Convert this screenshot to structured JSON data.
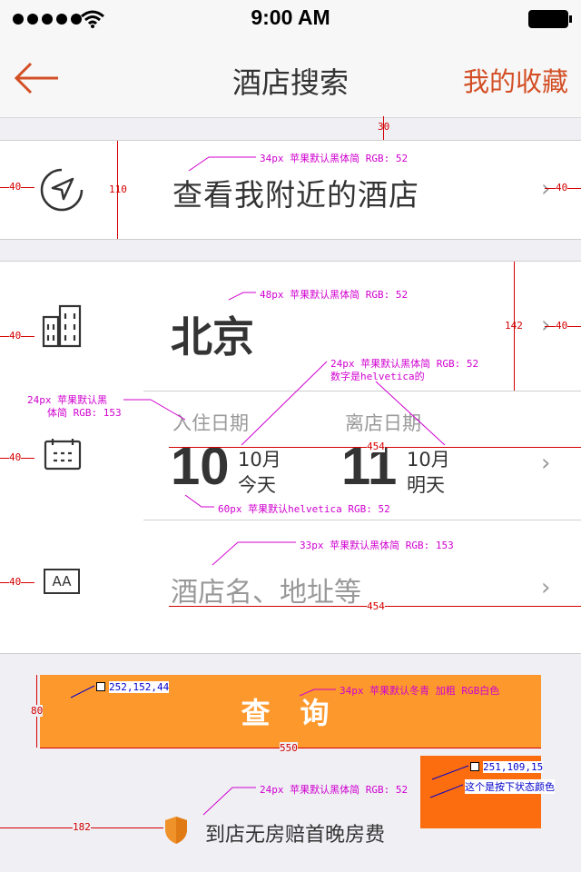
{
  "status_bar": {
    "time": "9:00 AM"
  },
  "nav": {
    "title": "酒店搜索",
    "right_label": "我的收藏",
    "back_icon": "back-arrow-icon"
  },
  "nearby": {
    "label": "查看我附近的酒店",
    "icon": "location-arrow-icon"
  },
  "city": {
    "name": "北京",
    "icon": "buildings-icon"
  },
  "dates": {
    "checkin_label": "入住日期",
    "checkin_day": "10",
    "checkin_month": "10月",
    "checkin_rel": "今天",
    "checkout_label": "离店日期",
    "checkout_day": "11",
    "checkout_month": "10月",
    "checkout_rel": "明天",
    "icon": "calendar-icon"
  },
  "hotel_search": {
    "placeholder": "酒店名、地址等",
    "icon": "font-aa-icon"
  },
  "search_button": {
    "label": "查 询"
  },
  "footer": {
    "guarantee": "到店无房赔首晚房费",
    "icon": "shield-icon"
  },
  "annotations": {
    "a30": "30",
    "a110": "110",
    "a142": "142",
    "a80": "80",
    "a182": "182",
    "a550": "550",
    "a454": "454",
    "a454b": "454",
    "left40": "40",
    "spec_nearby": "34px  苹果默认黑体简 RGB: 52",
    "spec_city": "48px  苹果默认黑体简 RGB: 52",
    "spec_dates1": "24px  苹果默认黑体简 RGB: 52",
    "spec_dates2": "数字是helvetica的",
    "spec_label1": "24px  苹果默认黑",
    "spec_label2": "体简 RGB: 153",
    "spec_day": "60px  苹果默认helvetica RGB: 52",
    "spec_hotel": "33px  苹果默认黑体简 RGB: 153",
    "spec_button": "34px  苹果默认冬青  加粗  RGB白色",
    "spec_footer": "24px  苹果默认黑体简 RGB: 52",
    "color_normal": "252,152,44",
    "color_pressed": "251,109,15",
    "pressed_note": "这个是按下状态颜色"
  },
  "colors": {
    "accent": "#d34f25",
    "button": "#fc982c",
    "button_pressed": "#fb6d0f"
  }
}
